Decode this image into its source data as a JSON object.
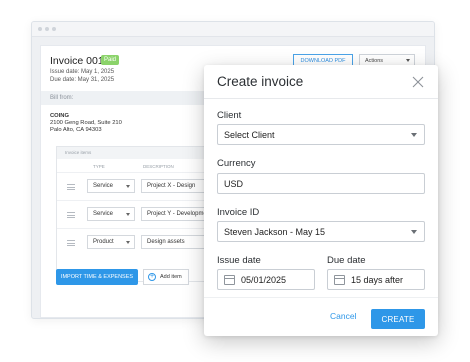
{
  "invoice": {
    "title": "Invoice 001",
    "status": "Paid",
    "issue_date": "Issue date: May 1, 2025",
    "due_date": "Due date: May 31, 2025",
    "download_label": "DOWNLOAD PDF",
    "actions_label": "Actions",
    "bill_from_label": "Bill from:",
    "company": {
      "name": "COING",
      "address1": "2100 Geng Road, Suite 210",
      "address2": "Palo Alto, CA 94303"
    },
    "items_header": "Invoice items",
    "columns": {
      "type": "TYPE",
      "description": "DESCRIPTION"
    },
    "items": [
      {
        "type": "Service",
        "description": "Project X - Design"
      },
      {
        "type": "Service",
        "description": "Project Y - Development"
      },
      {
        "type": "Product",
        "description": "Design assets"
      }
    ],
    "import_label": "IMPORT TIME & EXPENSES",
    "add_item_label": "Add item"
  },
  "modal": {
    "title": "Create invoice",
    "client_label": "Client",
    "client_value": "Select Client",
    "currency_label": "Currency",
    "currency_value": "USD",
    "invoice_id_label": "Invoice ID",
    "invoice_id_value": "Steven Jackson - May 15",
    "issue_date_label": "Issue date",
    "issue_date_value": "05/01/2025",
    "due_date_label": "Due date",
    "due_date_value": "15 days after",
    "cancel_label": "Cancel",
    "create_label": "CREATE"
  },
  "colors": {
    "accent": "#2e97e8",
    "paid_badge": "#8bd36a"
  }
}
